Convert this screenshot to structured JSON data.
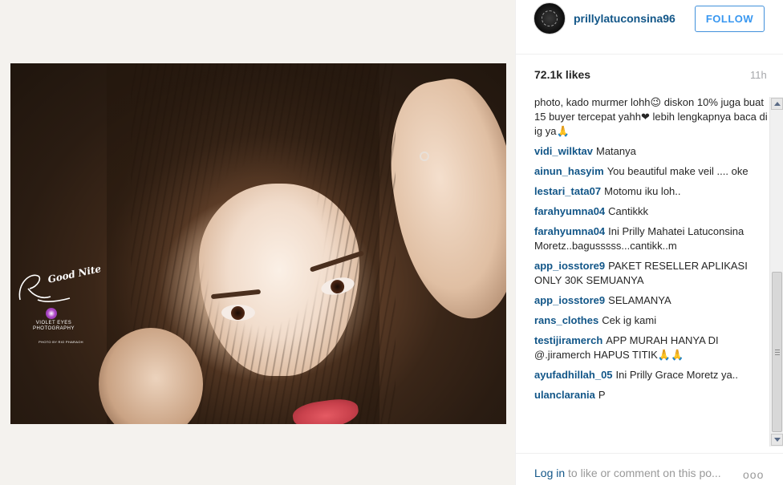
{
  "post": {
    "username": "prillylatuconsina96",
    "follow_label": "FOLLOW",
    "likes": "72.1k likes",
    "time": "11h"
  },
  "photo": {
    "watermark": {
      "logo_text": "Good Nite",
      "signature": "Prilly Latuconsina",
      "studio": "VIOLET EYES PHOTOGRAPHY",
      "credit": "PHOTO BY RIO PHARAOH"
    }
  },
  "comments": [
    {
      "user": "",
      "text": "photo, kado murmer lohh😉 diskon 10% juga buat 15 buyer tercepat yahh❤ lebih lengkapnya baca di ig ya🙏"
    },
    {
      "user": "vidi_wilktav",
      "text": "Matanya"
    },
    {
      "user": "ainun_hasyim",
      "text": "You beautiful make veil .... oke"
    },
    {
      "user": "lestari_tata07",
      "text": "Motomu iku loh.."
    },
    {
      "user": "farahyumna04",
      "text": "Cantikkk"
    },
    {
      "user": "farahyumna04",
      "text": "Ini Prilly Mahatei Latuconsina Moretz..bagusssss...cantikk..m"
    },
    {
      "user": "app_iosstore9",
      "text": "PAKET RESELLER APLIKASI ONLY 30K SEMUANYA"
    },
    {
      "user": "app_iosstore9",
      "text": "SELAMANYA"
    },
    {
      "user": "rans_clothes",
      "text": "Cek ig kami"
    },
    {
      "user": "testijiramerch",
      "text": "APP MURAH HANYA DI @.jiramerch HAPUS TITIK🙏🙏"
    },
    {
      "user": "ayufadhillah_05",
      "text": "Ini Prilly Grace Moretz ya.."
    },
    {
      "user": "ulanclarania",
      "text": "P"
    }
  ],
  "footer": {
    "login_link": "Log in",
    "rest": " to like or comment on this po...",
    "more": "ooo"
  },
  "colors": {
    "username": "#125688",
    "follow": "#3897f0",
    "muted": "#999999"
  },
  "icons": [
    "avatar-icon",
    "scroll-up-arrow-icon",
    "scroll-down-arrow-icon",
    "more-options-icon"
  ]
}
